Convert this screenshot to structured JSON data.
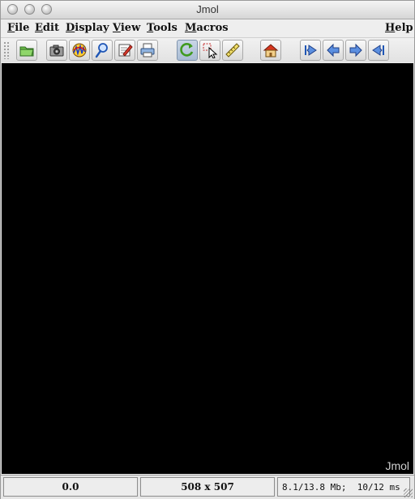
{
  "window": {
    "title": "Jmol"
  },
  "menubar": {
    "items": [
      {
        "label": "File",
        "hint": "F"
      },
      {
        "label": "Edit",
        "hint": "E"
      },
      {
        "label": "Display",
        "hint": "D"
      },
      {
        "label": "View",
        "hint": "V"
      },
      {
        "label": "Tools",
        "hint": "T"
      },
      {
        "label": "Macros",
        "hint": "M"
      },
      {
        "label": "Help",
        "hint": "H"
      }
    ]
  },
  "toolbar": {
    "buttons": [
      {
        "icon": "open-folder-icon"
      },
      {
        "icon": "camera-icon"
      },
      {
        "icon": "spectrum-icon"
      },
      {
        "icon": "magnifier-icon"
      },
      {
        "icon": "editor-icon"
      },
      {
        "icon": "print-icon"
      },
      {
        "icon": "rotate-icon",
        "pressed": true
      },
      {
        "icon": "pick-icon"
      },
      {
        "icon": "ruler-icon"
      },
      {
        "icon": "home-icon"
      },
      {
        "icon": "first-frame-icon"
      },
      {
        "icon": "previous-frame-icon"
      },
      {
        "icon": "next-frame-icon"
      },
      {
        "icon": "last-frame-icon"
      }
    ]
  },
  "viewer": {
    "background": "#000000",
    "watermark": "Jmol"
  },
  "status": {
    "coordinate": "0.0",
    "dimensions": "508 x 507",
    "memory": "8.1/13.8 Mb;  10/12 ms"
  }
}
